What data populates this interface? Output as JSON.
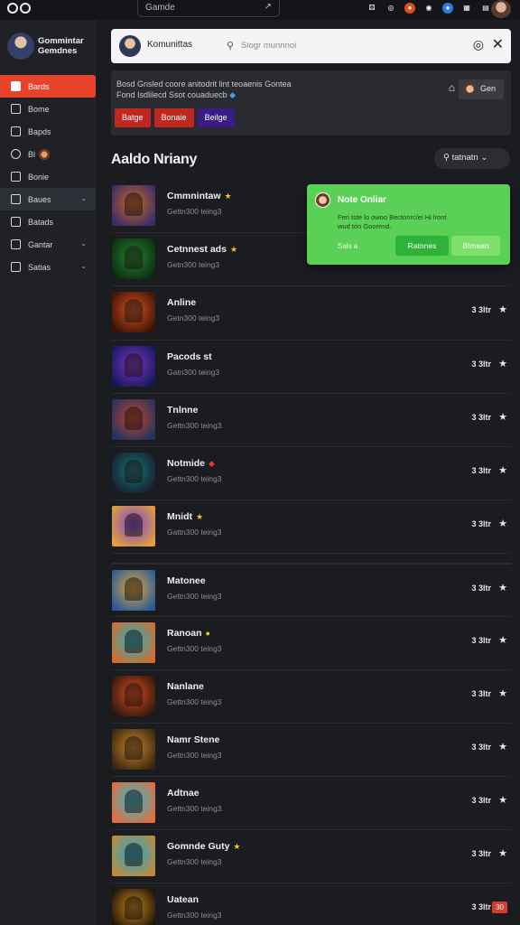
{
  "topbar": {
    "search_text": "Gamde",
    "search_ext_icon": "external-link-icon",
    "icons": [
      {
        "name": "puzzle-icon",
        "glyph": "⚄",
        "color": "#141518"
      },
      {
        "name": "refresh-icon",
        "glyph": "◎",
        "color": "#141518"
      },
      {
        "name": "record-icon",
        "glyph": "●",
        "color": "#e24a1f"
      },
      {
        "name": "shield-icon",
        "glyph": "◉",
        "color": "#141518"
      },
      {
        "name": "profile-icon",
        "glyph": "●",
        "color": "#2f7be6"
      },
      {
        "name": "grid-icon",
        "glyph": "▦",
        "color": "#141518"
      },
      {
        "name": "calendar-icon",
        "glyph": "▤",
        "color": "#141518"
      }
    ]
  },
  "sidebar": {
    "profile_name_line1": "Gommintar",
    "profile_name_line2": "Gemdnes",
    "items": [
      {
        "label": "Bards",
        "icon": "home-icon",
        "state": "active"
      },
      {
        "label": "Bome",
        "icon": "library-icon",
        "state": ""
      },
      {
        "label": "Bapds",
        "icon": "store-icon",
        "state": ""
      },
      {
        "label": "Bl",
        "icon": "circle-icon",
        "state": ""
      },
      {
        "label": "Bonie",
        "icon": "news-icon",
        "state": ""
      },
      {
        "label": "Baues",
        "icon": "folder-icon",
        "state": "selected"
      },
      {
        "label": "Batads",
        "icon": "stats-icon",
        "state": ""
      },
      {
        "label": "Gantar",
        "icon": "chat-icon",
        "state": ""
      },
      {
        "label": "Satias",
        "icon": "settings-icon",
        "state": ""
      }
    ]
  },
  "search": {
    "brand": "Komunittas",
    "placeholder": "Siogr munnnoi",
    "search_icon": "search-icon",
    "action_icon": "discord-icon",
    "close_icon": "close-icon"
  },
  "notice": {
    "line1": "Bosd Gnsled coore anitodrit lint teoaenis Gontea",
    "line2": "Fond Isdlilecd Ssot couaduecb",
    "home_icon": "home-icon",
    "gen_label": "Gen",
    "tags": [
      {
        "label": "Batge",
        "color": "#c0271f"
      },
      {
        "label": "Bonaie",
        "color": "#c0271f"
      },
      {
        "label": "Beilge",
        "color": "#3a1b87"
      }
    ]
  },
  "section": {
    "title": "Aaldo Nriany",
    "filter_label": "tatnatn"
  },
  "toast": {
    "title": "Note Onliar",
    "body_line1": "Feri tste lo owoo Bectonrc/ei Hi lront",
    "body_line2": "wud ton Goorend.",
    "link": "Sals a",
    "btn_primary": "Ratnnes",
    "btn_secondary": "Btmean"
  },
  "games": [
    {
      "title": "Cmmnintaw",
      "badge": "★",
      "badge_color": "#f4c62a",
      "sub": "Gettn300 teing3",
      "meta": "",
      "action": "",
      "thumb": "#c96a1c,#3a2a6b"
    },
    {
      "title": "Cetnnest ads",
      "badge": "★",
      "badge_color": "#f4c62a",
      "sub": "Getn300 teing3",
      "meta": "",
      "action": "",
      "thumb": "#1e8a2a,#0d2a12"
    },
    {
      "title": "Anline",
      "badge": "",
      "badge_color": "",
      "sub": "Getn300 teing3",
      "meta": "3 3ltr",
      "action": "★",
      "thumb": "#d8531c,#3b1208"
    },
    {
      "title": "Pacods st",
      "badge": "",
      "badge_color": "",
      "sub": "Gatn300 teing3",
      "meta": "3 3ltr",
      "action": "★",
      "thumb": "#7b34c7,#151a5a"
    },
    {
      "title": "Tnlnne",
      "badge": "",
      "badge_color": "",
      "sub": "Gettn300 teing3",
      "meta": "3 3ltr",
      "action": "★",
      "thumb": "#c9432c,#20335e"
    },
    {
      "title": "Notmide",
      "badge": "◆",
      "badge_color": "#e23a2a",
      "sub": "Gettn300 teing3",
      "meta": "3 3ltr",
      "action": "★",
      "thumb": "#0e7a7a,#1a1a2a"
    },
    {
      "title": "Mnidt",
      "badge": "★",
      "badge_color": "#f4c62a",
      "sub": "Gattn300 teing3",
      "meta": "3 3ltr",
      "action": "★",
      "thumb": "#7a45d8,#e2a03a"
    },
    {
      "title": "Matonee",
      "badge": "",
      "badge_color": "",
      "sub": "Gettn300 teing3",
      "meta": "3 3ltr",
      "action": "★",
      "thumb": "#e2a934,#2a5a9a"
    },
    {
      "title": "Ranoan",
      "badge": "●",
      "badge_color": "#f4c62a",
      "sub": "Gettn300 teing3",
      "meta": "3 3ltr",
      "action": "★",
      "thumb": "#1ab8c8,#d86a2a"
    },
    {
      "title": "Nanlane",
      "badge": "",
      "badge_color": "",
      "sub": "Gettn300 teing3",
      "meta": "3 3ltr",
      "action": "★",
      "thumb": "#e34a1a,#2a1810"
    },
    {
      "title": "Namr Stene",
      "badge": "",
      "badge_color": "",
      "sub": "Gettn300 teing3",
      "meta": "3 3ltr",
      "action": "★",
      "thumb": "#c8862a,#3a2610"
    },
    {
      "title": "Adtnae",
      "badge": "",
      "badge_color": "",
      "sub": "Gettn300 teing3",
      "meta": "3 3ltr",
      "action": "★",
      "thumb": "#25c2d6,#e86a3a"
    },
    {
      "title": "Gomnde Guty",
      "badge": "★",
      "badge_color": "#f4c62a",
      "sub": "Gettn300 teing3",
      "meta": "3 3ltr",
      "action": "★",
      "thumb": "#1aa8d6,#c28a3a"
    },
    {
      "title": "Uatean",
      "badge": "",
      "badge_color": "",
      "sub": "Gettn300 teing3",
      "meta": "3 3ltr",
      "action": "30",
      "thumb": "#c8861a,#1a1208"
    }
  ]
}
